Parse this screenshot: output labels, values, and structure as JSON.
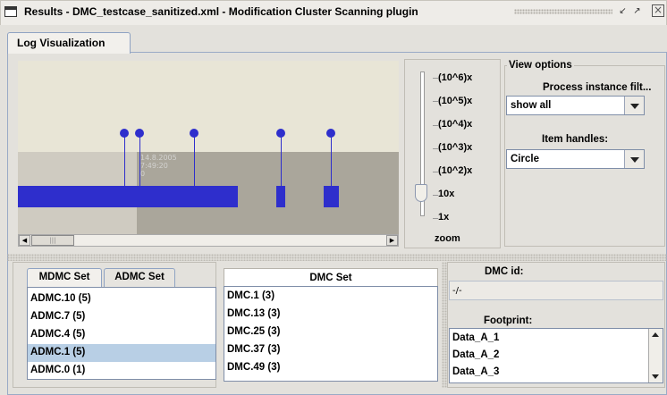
{
  "window": {
    "title": "Results - DMC_testcase_sanitized.xml - Modification Cluster Scanning plugin",
    "close_glyph": "⊠",
    "min_glyph": "↙",
    "max_glyph": "↗"
  },
  "tabs": {
    "active": "Log Visualization"
  },
  "visualization": {
    "faded_text_1": "14.8.2005",
    "faded_text_2": "7:49:20",
    "faded_text_3": "0"
  },
  "scroll": {
    "left_glyph": "◀",
    "right_glyph": "▶",
    "thumb_glyph": "|||"
  },
  "zoom": {
    "levels": [
      "(10^6)x",
      "(10^5)x",
      "(10^4)x",
      "(10^3)x",
      "(10^2)x",
      "10x",
      "1x"
    ],
    "label": "zoom",
    "selected_level": "10x"
  },
  "view_options": {
    "title": "View options",
    "process_filter_label": "Process instance filt...",
    "process_filter_value": "show all",
    "item_handles_label": "Item handles:",
    "item_handles_value": "Circle"
  },
  "sets": {
    "tabs": [
      "MDMC Set",
      "ADMC Set"
    ],
    "active_tab": "MDMC Set",
    "mdmc_items": [
      "ADMC.10 (5)",
      "ADMC.7 (5)",
      "ADMC.4 (5)",
      "ADMC.1 (5)",
      "ADMC.0 (1)"
    ],
    "selected_item": "ADMC.1 (5)",
    "dmc_header": "DMC Set",
    "dmc_items": [
      "DMC.1 (3)",
      "DMC.13 (3)",
      "DMC.25 (3)",
      "DMC.37 (3)",
      "DMC.49 (3)"
    ]
  },
  "details": {
    "dmc_id_label": "DMC id:",
    "dmc_id_value": "-/-",
    "footprint_label": "Footprint:",
    "footprint_items": [
      "Data_A_1",
      "Data_A_2",
      "Data_A_3"
    ]
  },
  "colors": {
    "event_blue": "#2e2ecc",
    "selection": "#b8cfe5",
    "tab_border": "#8fa3c3"
  }
}
